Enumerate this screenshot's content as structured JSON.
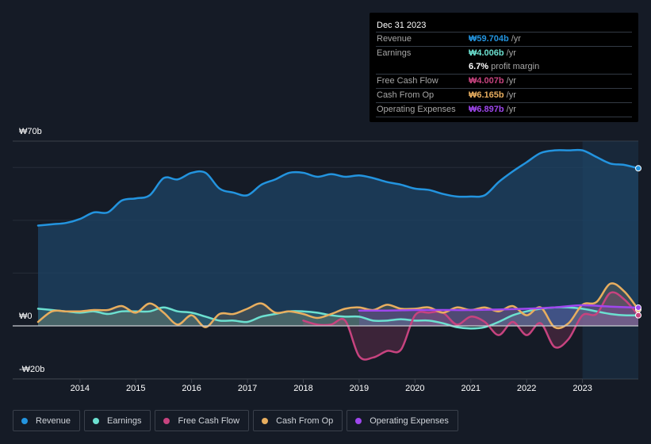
{
  "tooltip": {
    "date": "Dec 31 2023",
    "rows": [
      {
        "label": "Revenue",
        "value": "₩59.704b",
        "unit": "/yr",
        "color": "#2394df"
      },
      {
        "label": "Earnings",
        "value": "₩4.006b",
        "unit": "/yr",
        "color": "#6ce0d0"
      },
      {
        "label": "",
        "value": "6.7%",
        "unit": "profit margin",
        "color": "#ffffff"
      },
      {
        "label": "Free Cash Flow",
        "value": "₩4.007b",
        "unit": "/yr",
        "color": "#c7437f"
      },
      {
        "label": "Cash From Op",
        "value": "₩6.165b",
        "unit": "/yr",
        "color": "#e8ae5f"
      },
      {
        "label": "Operating Expenses",
        "value": "₩6.897b",
        "unit": "/yr",
        "color": "#9f47ee"
      }
    ]
  },
  "legend": [
    {
      "label": "Revenue",
      "color": "#2394df"
    },
    {
      "label": "Earnings",
      "color": "#6ce0d0"
    },
    {
      "label": "Free Cash Flow",
      "color": "#c7437f"
    },
    {
      "label": "Cash From Op",
      "color": "#e8ae5f"
    },
    {
      "label": "Operating Expenses",
      "color": "#9f47ee"
    }
  ],
  "chart_data": {
    "type": "area",
    "title": "",
    "xlabel": "",
    "ylabel": "",
    "y_tick_labels": [
      "₩70b",
      "₩0",
      "-₩20b"
    ],
    "ylim": [
      -20,
      70
    ],
    "xlim": [
      2013.25,
      2024.0
    ],
    "x_ticks": [
      2014,
      2015,
      2016,
      2017,
      2018,
      2019,
      2020,
      2021,
      2022,
      2023
    ],
    "grid": true,
    "legend_position": "bottom",
    "highlight_from": 2023.0,
    "series": [
      {
        "name": "Revenue",
        "color": "#2394df",
        "x": [
          2013.25,
          2013.5,
          2013.75,
          2014.0,
          2014.25,
          2014.5,
          2014.75,
          2015.0,
          2015.25,
          2015.5,
          2015.75,
          2016.0,
          2016.25,
          2016.5,
          2016.75,
          2017.0,
          2017.25,
          2017.5,
          2017.75,
          2018.0,
          2018.25,
          2018.5,
          2018.75,
          2019.0,
          2019.25,
          2019.5,
          2019.75,
          2020.0,
          2020.25,
          2020.5,
          2020.75,
          2021.0,
          2021.25,
          2021.5,
          2021.75,
          2022.0,
          2022.25,
          2022.5,
          2022.75,
          2023.0,
          2023.25,
          2023.5,
          2023.75,
          2024.0
        ],
        "values": [
          38.0,
          38.5,
          39.0,
          40.5,
          43.0,
          43.0,
          47.5,
          48.3,
          49.5,
          56.0,
          55.5,
          58.0,
          58.0,
          52.0,
          50.5,
          49.5,
          53.5,
          55.5,
          58.0,
          58.0,
          56.5,
          57.5,
          56.5,
          57.0,
          56.0,
          54.5,
          53.5,
          52.0,
          51.5,
          50.0,
          49.0,
          49.0,
          49.5,
          54.5,
          58.5,
          62.0,
          65.5,
          66.5,
          66.5,
          66.5,
          64.0,
          61.5,
          61.0,
          59.7
        ]
      },
      {
        "name": "Earnings",
        "color": "#6ce0d0",
        "x": [
          2013.25,
          2013.5,
          2013.75,
          2014.0,
          2014.25,
          2014.5,
          2014.75,
          2015.0,
          2015.25,
          2015.5,
          2015.75,
          2016.0,
          2016.25,
          2016.5,
          2016.75,
          2017.0,
          2017.25,
          2017.5,
          2017.75,
          2018.0,
          2018.25,
          2018.5,
          2018.75,
          2019.0,
          2019.25,
          2019.5,
          2019.75,
          2020.0,
          2020.25,
          2020.5,
          2020.75,
          2021.0,
          2021.25,
          2021.5,
          2021.75,
          2022.0,
          2022.25,
          2022.5,
          2022.75,
          2023.0,
          2023.25,
          2023.5,
          2023.75,
          2024.0
        ],
        "values": [
          6.5,
          6.0,
          5.5,
          5.0,
          5.5,
          4.5,
          5.5,
          5.5,
          5.5,
          7.0,
          5.5,
          5.0,
          3.5,
          2.0,
          2.0,
          1.5,
          3.5,
          4.5,
          5.5,
          5.5,
          5.0,
          4.0,
          3.5,
          3.5,
          2.0,
          2.0,
          2.5,
          2.0,
          2.0,
          1.0,
          -0.5,
          -1.0,
          -0.5,
          1.5,
          4.0,
          5.5,
          6.5,
          7.0,
          7.0,
          6.5,
          5.5,
          4.5,
          4.0,
          4.0
        ]
      },
      {
        "name": "Free Cash Flow",
        "color": "#c7437f",
        "x": [
          2018.0,
          2018.25,
          2018.5,
          2018.75,
          2019.0,
          2019.25,
          2019.5,
          2019.75,
          2020.0,
          2020.25,
          2020.5,
          2020.75,
          2021.0,
          2021.25,
          2021.5,
          2021.75,
          2022.0,
          2022.25,
          2022.5,
          2022.75,
          2023.0,
          2023.25,
          2023.5,
          2023.75,
          2024.0
        ],
        "values": [
          2.0,
          0.5,
          0.5,
          2.0,
          -11.5,
          -12.0,
          -9.5,
          -9.0,
          4.0,
          5.0,
          5.0,
          0.5,
          3.5,
          1.5,
          -3.5,
          1.5,
          -3.5,
          1.0,
          -8.0,
          -5.0,
          4.0,
          4.5,
          12.5,
          10.0,
          4.0
        ]
      },
      {
        "name": "Cash From Op",
        "color": "#e8ae5f",
        "x": [
          2013.25,
          2013.5,
          2013.75,
          2014.0,
          2014.25,
          2014.5,
          2014.75,
          2015.0,
          2015.25,
          2015.5,
          2015.75,
          2016.0,
          2016.25,
          2016.5,
          2016.75,
          2017.0,
          2017.25,
          2017.5,
          2017.75,
          2018.0,
          2018.25,
          2018.5,
          2018.75,
          2019.0,
          2019.25,
          2019.5,
          2019.75,
          2020.0,
          2020.25,
          2020.5,
          2020.75,
          2021.0,
          2021.25,
          2021.5,
          2021.75,
          2022.0,
          2022.25,
          2022.5,
          2022.75,
          2023.0,
          2023.25,
          2023.5,
          2023.75,
          2024.0
        ],
        "values": [
          1.5,
          5.5,
          5.5,
          5.5,
          6.0,
          6.0,
          7.5,
          5.0,
          8.5,
          5.0,
          0.5,
          4.0,
          -0.5,
          4.5,
          4.5,
          6.5,
          8.5,
          5.0,
          5.5,
          4.5,
          3.0,
          4.5,
          6.5,
          7.0,
          6.0,
          8.0,
          6.5,
          6.5,
          7.0,
          5.0,
          7.0,
          6.0,
          7.0,
          5.5,
          7.5,
          4.0,
          7.0,
          -0.5,
          1.0,
          8.0,
          9.0,
          16.0,
          13.0,
          6.2
        ]
      },
      {
        "name": "Operating Expenses",
        "color": "#9f47ee",
        "x": [
          2019.0,
          2019.5,
          2020.0,
          2020.5,
          2021.0,
          2021.5,
          2022.0,
          2022.5,
          2023.0,
          2023.5,
          2024.0
        ],
        "values": [
          5.8,
          5.8,
          6.0,
          6.0,
          6.0,
          6.2,
          6.5,
          7.0,
          7.8,
          7.3,
          6.9
        ]
      }
    ]
  }
}
